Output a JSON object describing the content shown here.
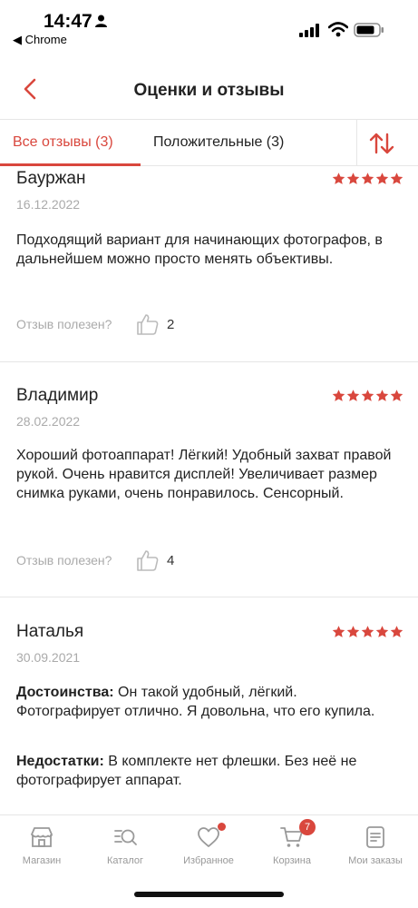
{
  "status_bar": {
    "time": "14:47",
    "back_app": "◀ Chrome"
  },
  "header": {
    "title": "Оценки и отзывы"
  },
  "tabs": [
    {
      "label": "Все отзывы (3)",
      "active": true
    },
    {
      "label": "Положительные (3)",
      "active": false
    }
  ],
  "reviews": [
    {
      "author": "Бауржан",
      "rating": 5,
      "date": "16.12.2022",
      "text": "Подходящий вариант для начинающих фотографов, в дальнейшем можно просто менять объективы.",
      "helpful_label": "Отзыв полезен?",
      "likes": "2"
    },
    {
      "author": "Владимир",
      "rating": 5,
      "date": "28.02.2022",
      "text": "Хороший фотоаппарат! Лёгкий! Удобный захват правой рукой. Очень нравится дисплей! Увеличивает размер снимка руками, очень понравилось. Сенсорный.",
      "helpful_label": "Отзыв полезен?",
      "likes": "4"
    },
    {
      "author": "Наталья",
      "rating": 5,
      "date": "30.09.2021",
      "pros_label": "Достоинства:",
      "pros": " Он такой удобный, лёгкий. Фотографирует отлично. Я довольна, что его купила.",
      "cons_label": "Недостатки:",
      "cons": " В комплекте нет флешки. Без неё не фотографирует аппарат."
    }
  ],
  "bottom_nav": [
    {
      "label": "Магазин",
      "icon": "store-icon"
    },
    {
      "label": "Каталог",
      "icon": "catalog-search-icon"
    },
    {
      "label": "Избранное",
      "icon": "heart-icon",
      "dot": true
    },
    {
      "label": "Корзина",
      "icon": "cart-icon",
      "badge": "7"
    },
    {
      "label": "Мои заказы",
      "icon": "orders-icon"
    }
  ],
  "colors": {
    "accent": "#d9473d",
    "muted": "#aaaaaa",
    "text": "#222222"
  }
}
